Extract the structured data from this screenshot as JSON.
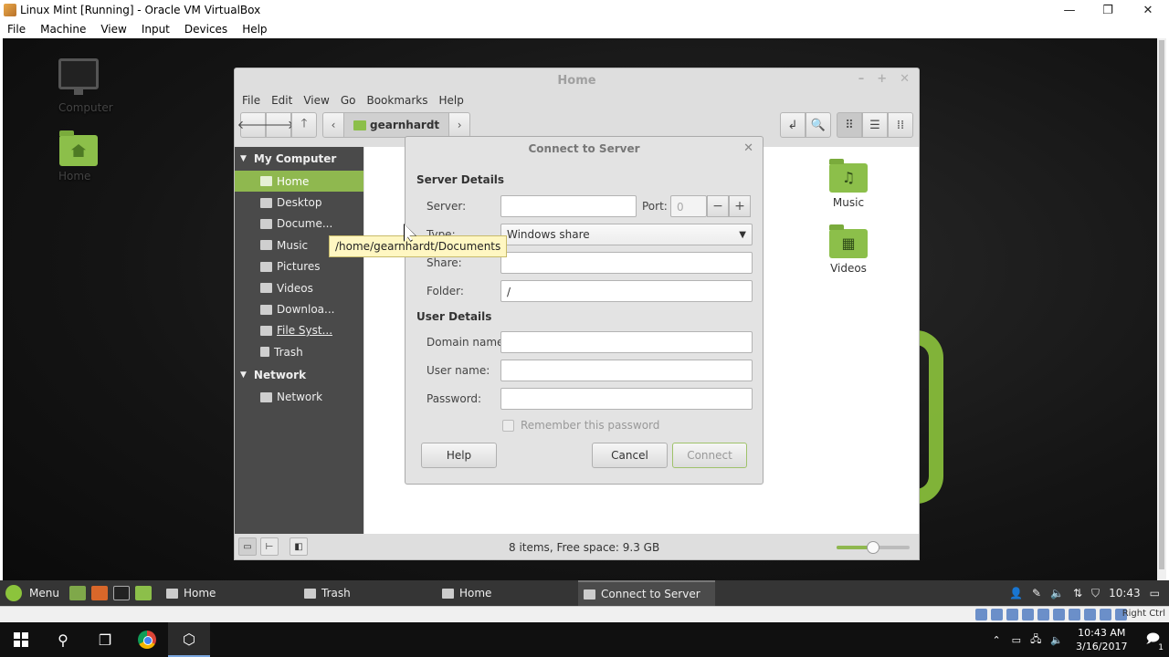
{
  "vbox": {
    "title": "Linux Mint [Running] - Oracle VM VirtualBox",
    "menu": [
      "File",
      "Machine",
      "View",
      "Input",
      "Devices",
      "Help"
    ],
    "status_right": "Right Ctrl"
  },
  "desktop": {
    "icons": [
      {
        "label": "Computer"
      },
      {
        "label": "Home"
      }
    ]
  },
  "nemo": {
    "title": "Home",
    "menu": [
      "File",
      "Edit",
      "View",
      "Go",
      "Bookmarks",
      "Help"
    ],
    "location": "gearnhardt",
    "sidebar": {
      "sections": [
        {
          "title": "My Computer",
          "items": [
            "Home",
            "Desktop",
            "Docume...",
            "Music",
            "Pictures",
            "Videos",
            "Downloa...",
            "File Syst...",
            "Trash"
          ]
        },
        {
          "title": "Network",
          "items": [
            "Network"
          ]
        }
      ]
    },
    "files": [
      {
        "label": "Music",
        "glyph": "♫"
      },
      {
        "label": "Videos",
        "glyph": "▦"
      }
    ],
    "status": "8 items, Free space: 9.3 GB",
    "zoom": 0.5
  },
  "tooltip": "/home/gearnhardt/Documents",
  "dialog": {
    "title": "Connect to Server",
    "server_details": "Server Details",
    "labels": {
      "server": "Server:",
      "port": "Port:",
      "type": "Type:",
      "share": "Share:",
      "folder": "Folder:"
    },
    "values": {
      "server": "",
      "port": "0",
      "type": "Windows share",
      "share": "",
      "folder": "/"
    },
    "user_details": "User Details",
    "user_labels": {
      "domain": "Domain name:",
      "user": "User name:",
      "password": "Password:"
    },
    "remember": "Remember this password",
    "buttons": {
      "help": "Help",
      "cancel": "Cancel",
      "connect": "Connect"
    }
  },
  "panel": {
    "menu_label": "Menu",
    "tasks": [
      "Home",
      "Trash",
      "Home",
      "Connect to Server"
    ],
    "time": "10:43"
  },
  "windows": {
    "time": "10:43 AM",
    "date": "3/16/2017",
    "notifications": "1"
  }
}
